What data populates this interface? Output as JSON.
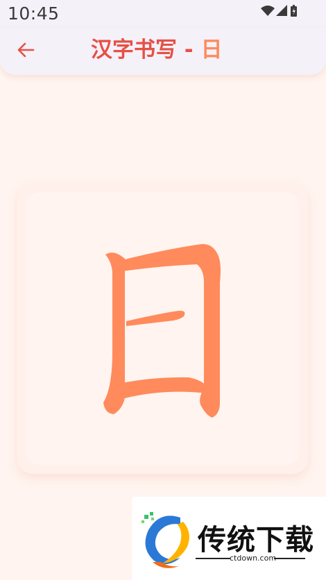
{
  "status_bar": {
    "time": "10:45",
    "icons": [
      "wifi-icon",
      "signal-icon",
      "battery-icon"
    ]
  },
  "app_bar": {
    "back_icon": "arrow-left-icon",
    "title_prefix": "汉字书写 - ",
    "character": "日",
    "colors": {
      "title": "#e65046",
      "character": "#ff8a5c",
      "back": "#e65046"
    }
  },
  "practice_card": {
    "character": "日",
    "stroke_color": "#ff8a5c"
  },
  "watermark": {
    "brand": "传统下载",
    "url": "ctdown.com"
  }
}
